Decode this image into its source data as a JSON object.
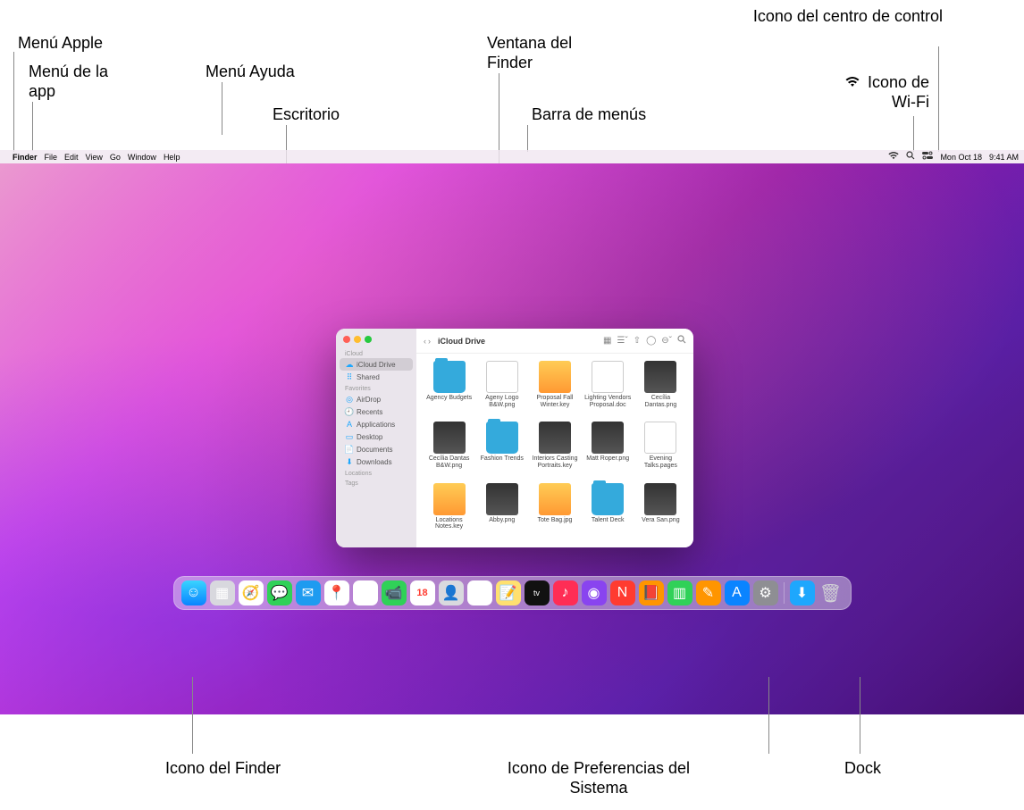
{
  "callouts": {
    "apple_menu": "Menú Apple",
    "app_menu": "Menú de la app",
    "help_menu": "Menú Ayuda",
    "desktop": "Escritorio",
    "finder_window": "Ventana del Finder",
    "menu_bar": "Barra de menús",
    "control_center": "Icono del centro de control",
    "wifi": "Icono de Wi-Fi",
    "finder_icon": "Icono del Finder",
    "sys_prefs": "Icono de Preferencias del Sistema",
    "dock": "Dock"
  },
  "menubar": {
    "app_name": "Finder",
    "items": [
      "File",
      "Edit",
      "View",
      "Go",
      "Window",
      "Help"
    ],
    "date": "Mon Oct 18",
    "time": "9:41 AM"
  },
  "finder": {
    "title": "iCloud Drive",
    "sidebar": {
      "sections": [
        {
          "label": "iCloud",
          "items": [
            {
              "icon": "cloud-icon",
              "label": "iCloud Drive",
              "color": "#1ea7fd",
              "selected": true
            },
            {
              "icon": "shared-icon",
              "label": "Shared",
              "color": "#1ea7fd"
            }
          ]
        },
        {
          "label": "Favorites",
          "items": [
            {
              "icon": "airdrop-icon",
              "label": "AirDrop",
              "color": "#1ea7fd"
            },
            {
              "icon": "clock-icon",
              "label": "Recents",
              "color": "#1ea7fd"
            },
            {
              "icon": "apps-icon",
              "label": "Applications",
              "color": "#1ea7fd"
            },
            {
              "icon": "desktop-icon",
              "label": "Desktop",
              "color": "#1ea7fd"
            },
            {
              "icon": "documents-icon",
              "label": "Documents",
              "color": "#1ea7fd"
            },
            {
              "icon": "downloads-icon",
              "label": "Downloads",
              "color": "#1ea7fd"
            }
          ]
        },
        {
          "label": "Locations",
          "items": []
        },
        {
          "label": "Tags",
          "items": []
        }
      ]
    },
    "files": [
      {
        "name": "Agency Budgets",
        "type": "folder"
      },
      {
        "name": "Ageny Logo B&W.png",
        "type": "doc"
      },
      {
        "name": "Proposal Fall Winter.key",
        "type": "key"
      },
      {
        "name": "Lighting Vendors Proposal.doc",
        "type": "doc"
      },
      {
        "name": "Cecília Dantas.png",
        "type": "img"
      },
      {
        "name": "Cecília Dantas B&W.png",
        "type": "img"
      },
      {
        "name": "Fashion Trends",
        "type": "folder"
      },
      {
        "name": "Interiors Casting Portraits.key",
        "type": "img"
      },
      {
        "name": "Matt Roper.png",
        "type": "img"
      },
      {
        "name": "Evening Talks.pages",
        "type": "doc"
      },
      {
        "name": "Locations Notes.key",
        "type": "key"
      },
      {
        "name": "Abby.png",
        "type": "img"
      },
      {
        "name": "Tote Bag.jpg",
        "type": "key"
      },
      {
        "name": "Talent Deck",
        "type": "folder"
      },
      {
        "name": "Vera San.png",
        "type": "img"
      }
    ]
  },
  "dock": {
    "items": [
      {
        "name": "finder",
        "bg": "linear-gradient(#3ad4ff,#0a84ff)",
        "glyph": "☺"
      },
      {
        "name": "launchpad",
        "bg": "#d8d8de",
        "glyph": "▦"
      },
      {
        "name": "safari",
        "bg": "#fff",
        "glyph": "🧭"
      },
      {
        "name": "messages",
        "bg": "#30d158",
        "glyph": "💬"
      },
      {
        "name": "mail",
        "bg": "#1e9bf0",
        "glyph": "✉"
      },
      {
        "name": "maps",
        "bg": "#fff",
        "glyph": "📍"
      },
      {
        "name": "photos",
        "bg": "#fff",
        "glyph": "❀"
      },
      {
        "name": "facetime",
        "bg": "#30d158",
        "glyph": "📹"
      },
      {
        "name": "calendar",
        "bg": "#fff",
        "glyph": "18"
      },
      {
        "name": "contacts",
        "bg": "#d9d9de",
        "glyph": "👤"
      },
      {
        "name": "reminders",
        "bg": "#fff",
        "glyph": "☰"
      },
      {
        "name": "notes",
        "bg": "#ffe070",
        "glyph": "📝"
      },
      {
        "name": "tv",
        "bg": "#111",
        "glyph": "tv"
      },
      {
        "name": "music",
        "bg": "#ff2d55",
        "glyph": "♪"
      },
      {
        "name": "podcasts",
        "bg": "#8944ef",
        "glyph": "◉"
      },
      {
        "name": "news",
        "bg": "#ff3b30",
        "glyph": "N"
      },
      {
        "name": "books",
        "bg": "#ff9500",
        "glyph": "📕"
      },
      {
        "name": "numbers",
        "bg": "#30d158",
        "glyph": "▥"
      },
      {
        "name": "pages",
        "bg": "#ff9500",
        "glyph": "✎"
      },
      {
        "name": "app-store",
        "bg": "#0a84ff",
        "glyph": "A"
      },
      {
        "name": "system-preferences",
        "bg": "#8e8e93",
        "glyph": "⚙"
      },
      {
        "name": "separator"
      },
      {
        "name": "downloads-stack",
        "bg": "#1ea7fd",
        "glyph": "⬇"
      },
      {
        "name": "trash",
        "bg": "transparent",
        "glyph": "🗑"
      }
    ]
  }
}
